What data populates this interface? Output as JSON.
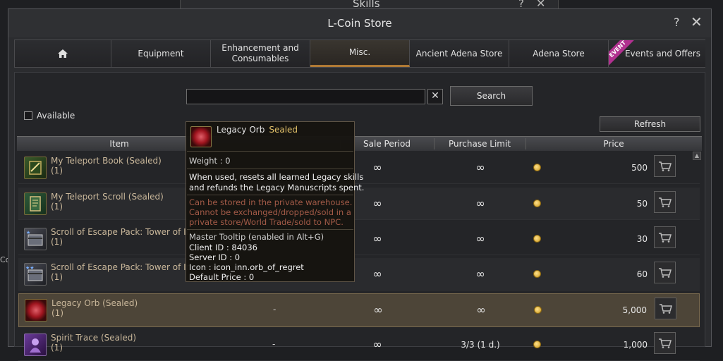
{
  "background": {
    "window_title": "Skills",
    "help_symbol": "?",
    "close_symbol": "✕",
    "side_text": "Co"
  },
  "window": {
    "title": "L-Coin Store",
    "help_symbol": "?",
    "close_symbol": "✕"
  },
  "tabs": [
    {
      "label": "",
      "icon": "home-icon"
    },
    {
      "label": "Equipment"
    },
    {
      "label": "Enhancement and Consumables"
    },
    {
      "label": "Misc.",
      "active": true
    },
    {
      "label": "Ancient Adena Store"
    },
    {
      "label": "Adena Store"
    },
    {
      "label": "Events and Offers",
      "ribbon": "EVENT"
    }
  ],
  "search": {
    "value": "",
    "clear_symbol": "✕",
    "button_label": "Search"
  },
  "filter": {
    "available_label": "Available",
    "checked": false
  },
  "refresh_label": "Refresh",
  "table": {
    "headers": [
      "Item",
      "Sale Period",
      "Purchase Limit",
      "Price"
    ],
    "rows": [
      {
        "name": "My Teleport Book (Sealed)",
        "qty": "(1)",
        "sale_period": "∞",
        "purchase_limit": "∞",
        "price": "500",
        "icon": "teleport-book-icon",
        "dash": ""
      },
      {
        "name": "My Teleport Scroll (Sealed)",
        "qty": "(1)",
        "sale_period": "∞",
        "purchase_limit": "∞",
        "price": "50",
        "icon": "teleport-scroll-icon",
        "dash": ""
      },
      {
        "name": "Scroll of Escape Pack: Tower of Insolence",
        "qty": "(1)",
        "sale_period": "∞",
        "purchase_limit": "∞",
        "price": "30",
        "icon": "escape-pack-icon",
        "dash": ""
      },
      {
        "name": "Scroll of Escape Pack: Tower of Insolence",
        "qty": "(1)",
        "sale_period": "∞",
        "purchase_limit": "∞",
        "price": "60",
        "icon": "escape-pack-icon",
        "dash": ""
      },
      {
        "name": "Legacy Orb (Sealed)",
        "qty": "(1)",
        "sale_period": "∞",
        "purchase_limit": "∞",
        "price": "5,000",
        "icon": "legacy-orb-icon",
        "dash": "-"
      },
      {
        "name": "Spirit Trace (Sealed)",
        "qty": "(1)",
        "sale_period": "∞",
        "purchase_limit": "3/3 (1 d.)",
        "price": "1,000",
        "icon": "spirit-trace-icon",
        "dash": "-"
      }
    ]
  },
  "tooltip": {
    "name": "Legacy Orb",
    "status": "Sealed",
    "weight": "Weight :  0",
    "description_1": "When used, resets all learned Legacy skills",
    "description_2": "and refunds the Legacy Manuscripts spent.",
    "restriction_1": "Can be stored in the private warehouse.",
    "restriction_2": "Cannot be exchanged/dropped/sold in a",
    "restriction_3": "private store/World Trade/sold to NPC.",
    "master_title": "Master Tooltip (enabled in Alt+G)",
    "client_id": "Client ID : 84036",
    "server_id": "Server ID : 0",
    "icon_name": "Icon : icon_inn.orb_of_regret",
    "default_price": "Default Price : 0"
  },
  "colors": {
    "accent": "#b07a35",
    "sealed": "#e3c26a",
    "item_name": "#c9b79a",
    "restriction": "#a25a47",
    "event_ribbon": "#b0308f"
  }
}
